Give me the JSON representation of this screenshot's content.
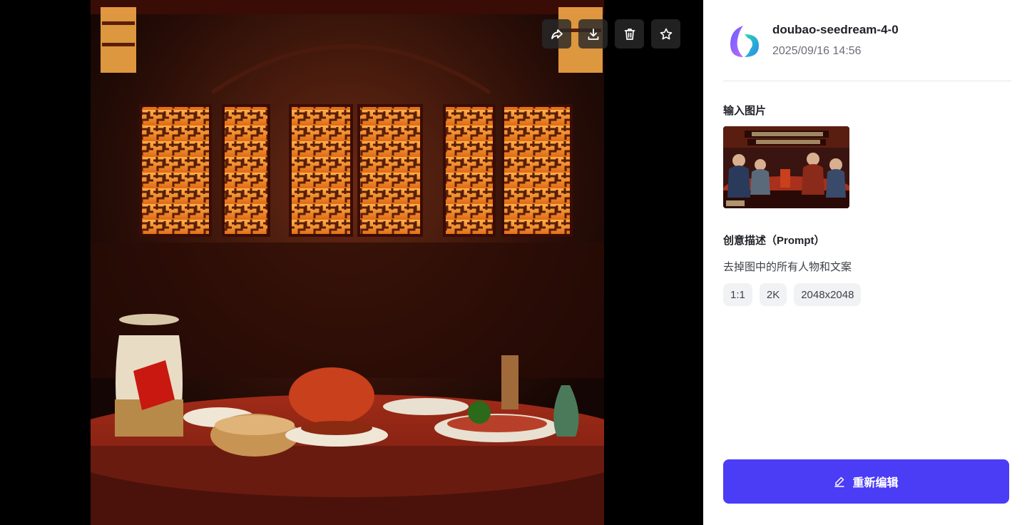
{
  "viewer": {
    "toolbar": {
      "share_icon": "share-arrow-icon",
      "download_icon": "download-icon",
      "delete_icon": "trash-icon",
      "favorite_icon": "star-icon"
    },
    "image_description_icon": "generated-image"
  },
  "panel": {
    "model_name": "doubao-seedream-4-0",
    "timestamp": "2025/09/16 14:56",
    "input_image_title": "输入图片",
    "prompt_title": "创意描述（Prompt）",
    "prompt_text": "去掉图中的所有人物和文案",
    "tags": [
      "1:1",
      "2K",
      "2048x2048"
    ],
    "reedit_label": "重新编辑",
    "close_icon": "close-icon"
  },
  "colors": {
    "accent": "#4b3cf6",
    "panel_bg": "#ffffff",
    "viewer_bg": "#000000"
  }
}
